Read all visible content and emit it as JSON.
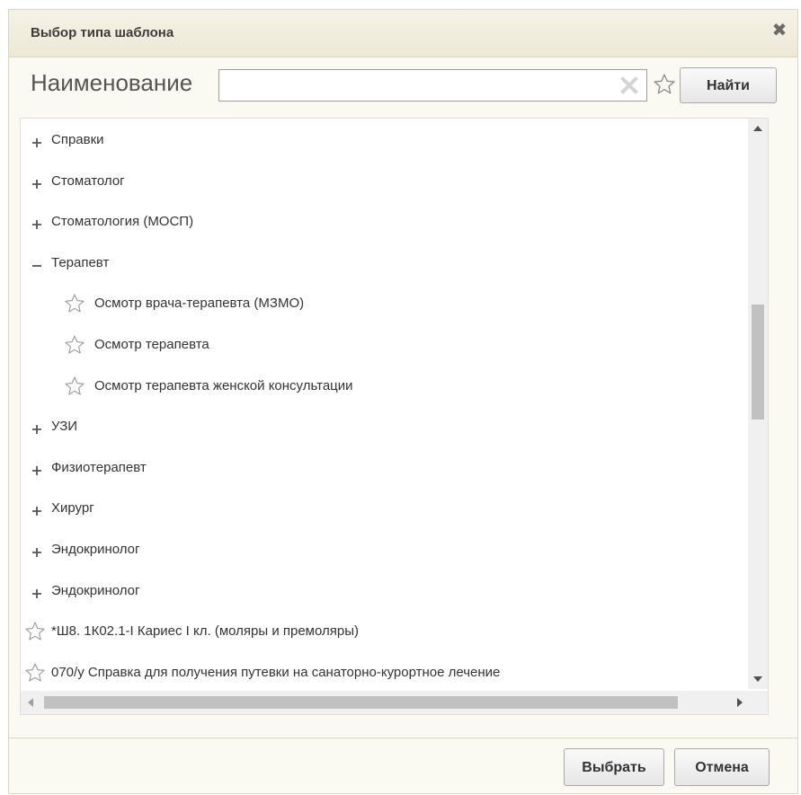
{
  "dialog": {
    "title": "Выбор типа шаблона",
    "close_icon": "close-icon"
  },
  "search": {
    "label": "Наименование",
    "value": "",
    "placeholder": "",
    "find_button": "Найти"
  },
  "tree": {
    "items": [
      {
        "kind": "group",
        "state": "collapsed",
        "label": "Справки"
      },
      {
        "kind": "group",
        "state": "collapsed",
        "label": "Стоматолог"
      },
      {
        "kind": "group",
        "state": "collapsed",
        "label": "Стоматология (МОСП)"
      },
      {
        "kind": "group",
        "state": "expanded",
        "label": "Терапевт"
      },
      {
        "kind": "leaf",
        "label": "Осмотр врача-терапевта (МЗМО)"
      },
      {
        "kind": "leaf",
        "label": "Осмотр терапевта"
      },
      {
        "kind": "leaf",
        "label": "Осмотр терапевта женской консультации"
      },
      {
        "kind": "group",
        "state": "collapsed",
        "label": "УЗИ"
      },
      {
        "kind": "group",
        "state": "collapsed",
        "label": "Физиотерапевт"
      },
      {
        "kind": "group",
        "state": "collapsed",
        "label": "Хирург"
      },
      {
        "kind": "group",
        "state": "collapsed",
        "label": "Эндокринолог"
      },
      {
        "kind": "group",
        "state": "collapsed",
        "label": "Эндокринолог"
      },
      {
        "kind": "root-leaf",
        "label": "*Ш8. 1К02.1-I Кариес I кл. (моляры и премоляры)"
      },
      {
        "kind": "root-leaf",
        "label": "070/у Справка для получения путевки на санаторно-курортное лечение"
      }
    ],
    "vertical_scroll_position": 0.4,
    "horizontal_scroll_position": 0.0
  },
  "footer": {
    "select_button": "Выбрать",
    "cancel_button": "Отмена"
  },
  "colors": {
    "dialog_bg": "#fbfaf2",
    "titlebar_bg": "#ebe8d6",
    "border": "#d9d6c4",
    "text": "#333333",
    "star_outline": "#9a9a9a"
  }
}
